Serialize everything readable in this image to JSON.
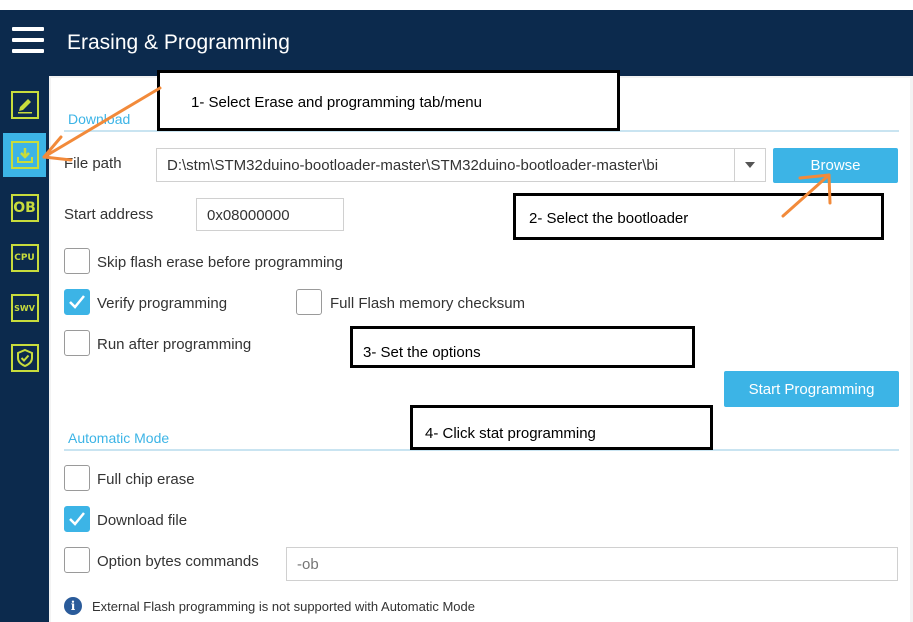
{
  "header": {
    "title": "Erasing & Programming"
  },
  "sidebar": {
    "items": [
      {
        "name": "edit",
        "label": ""
      },
      {
        "name": "erasing-programming",
        "label": ""
      },
      {
        "name": "option-bytes",
        "label": "OB"
      },
      {
        "name": "cpu",
        "label": "CPU"
      },
      {
        "name": "swv",
        "label": "SWV"
      },
      {
        "name": "security",
        "label": ""
      }
    ]
  },
  "download": {
    "section_label": "Download",
    "file_path_label": "File path",
    "file_path_value": "D:\\stm\\STM32duino-bootloader-master\\STM32duino-bootloader-master\\bi",
    "browse_label": "Browse",
    "start_address_label": "Start address",
    "start_address_value": "0x08000000",
    "skip_flash_erase_label": "Skip flash erase before programming",
    "verify_programming_label": "Verify programming",
    "full_flash_checksum_label": "Full Flash memory checksum",
    "run_after_programming_label": "Run after programming",
    "start_programming_label": "Start Programming"
  },
  "automatic_mode": {
    "section_label": "Automatic Mode",
    "full_chip_erase_label": "Full chip erase",
    "download_file_label": "Download file",
    "option_bytes_commands_label": "Option bytes commands",
    "option_bytes_placeholder": "-ob",
    "info_text": "External Flash programming is not supported with Automatic Mode"
  },
  "checkboxes": {
    "skip_flash_erase": false,
    "verify_programming": true,
    "full_flash_checksum": false,
    "run_after_programming": false,
    "full_chip_erase": false,
    "download_file": true,
    "option_bytes_commands": false
  },
  "annotations": {
    "step1": "1- Select Erase and programming tab/menu",
    "step2": "2- Select the bootloader",
    "step3": "3- Set the options",
    "step4": "4- Click stat programming"
  },
  "colors": {
    "header_bg": "#0c2a4d",
    "accent": "#3cb4e6",
    "sidebar_icon": "#c8dc3c",
    "arrow": "#f28a3a"
  }
}
